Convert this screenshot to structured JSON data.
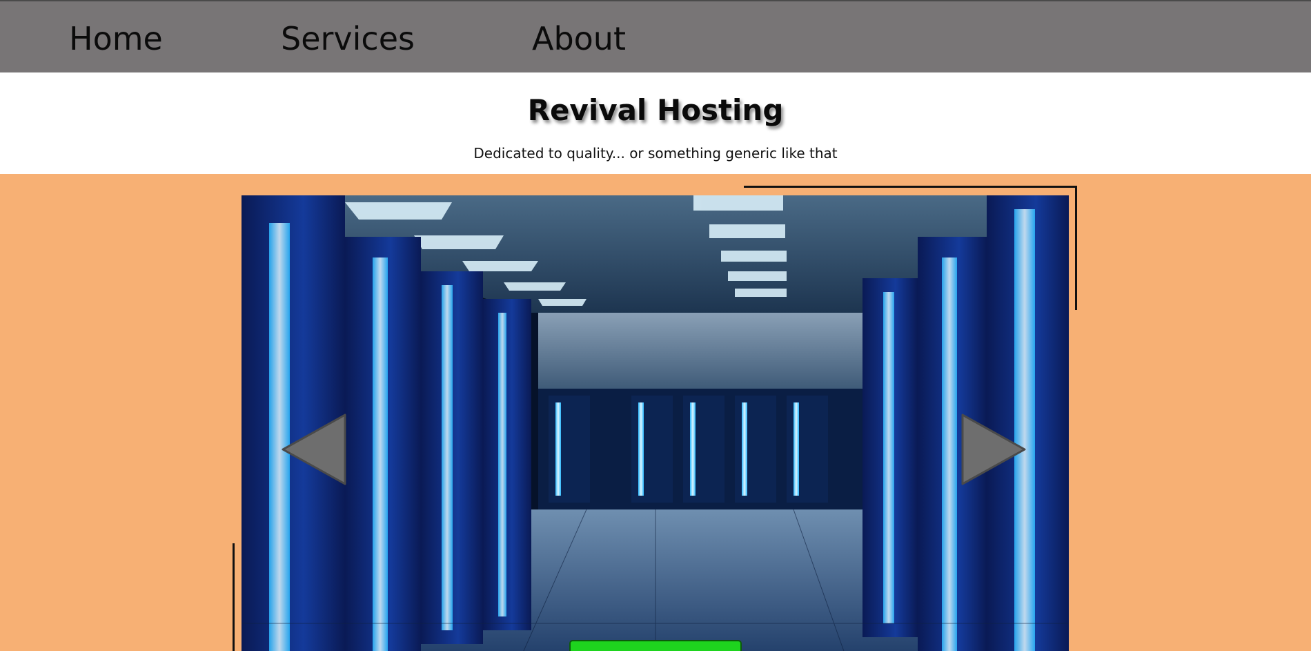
{
  "nav": {
    "items": [
      {
        "label": "Home"
      },
      {
        "label": "Services"
      },
      {
        "label": "About"
      }
    ],
    "background": "#787576"
  },
  "header": {
    "title": "Revival Hosting",
    "tagline": "Dedicated to quality... or something generic like that"
  },
  "main": {
    "background": "#f7b074",
    "slider": {
      "image_subject": "server-room-photo",
      "prev_icon": "triangle-left-icon",
      "next_icon": "triangle-right-icon"
    },
    "cta": {
      "color": "#1ed41e"
    }
  }
}
